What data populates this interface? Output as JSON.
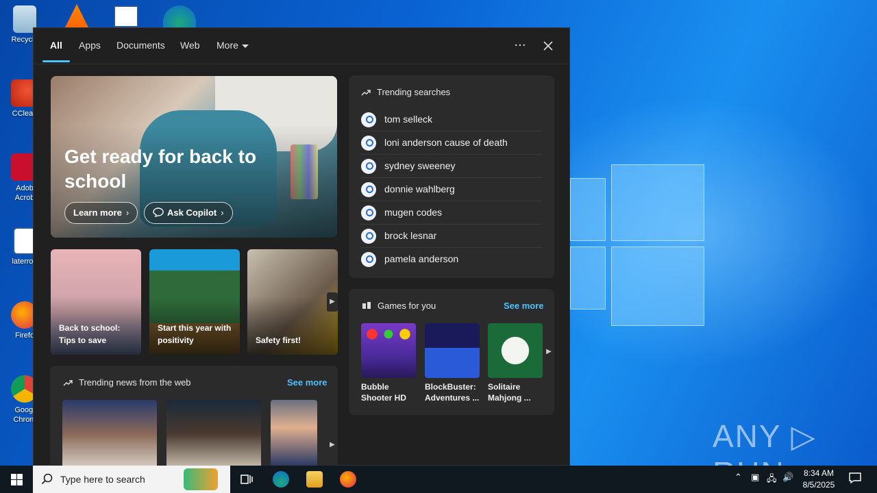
{
  "desktop": {
    "icons": [
      {
        "label": "Recycle"
      },
      {
        "label": "CClean"
      },
      {
        "label": "Adob\nAcrob"
      },
      {
        "label": "laterroa"
      },
      {
        "label": "Firefo"
      },
      {
        "label": "Googl\nChrom"
      }
    ],
    "watermark": "ANY ▷ RUN"
  },
  "search_panel": {
    "tabs": [
      "All",
      "Apps",
      "Documents",
      "Web",
      "More"
    ],
    "more_icon": "ellipsis-icon",
    "close_icon": "close-icon",
    "hero": {
      "title": "Get ready for back to school",
      "learn_more": "Learn more",
      "ask_copilot": "Ask Copilot"
    },
    "mini_cards": [
      {
        "caption": "Back to school: Tips to save"
      },
      {
        "caption": "Start this year with positivity"
      },
      {
        "caption": "Safety first!"
      }
    ],
    "trending_news": {
      "title": "Trending news from the web",
      "see_more": "See more"
    },
    "trending_searches": {
      "title": "Trending searches",
      "items": [
        "tom selleck",
        "loni anderson cause of death",
        "sydney sweeney",
        "donnie wahlberg",
        "mugen codes",
        "brock lesnar",
        "pamela anderson"
      ]
    },
    "games": {
      "title": "Games for you",
      "see_more": "See more",
      "items": [
        {
          "name": "Bubble\nShooter HD"
        },
        {
          "name": "BlockBuster:\nAdventures ..."
        },
        {
          "name": "Solitaire\nMahjong ..."
        }
      ]
    }
  },
  "taskbar": {
    "search_placeholder": "Type here to search",
    "time": "8:34 AM",
    "date": "8/5/2025"
  },
  "colors": {
    "accent": "#4cc2ff",
    "panel_bg": "#202020",
    "card_bg": "#2b2b2b"
  }
}
